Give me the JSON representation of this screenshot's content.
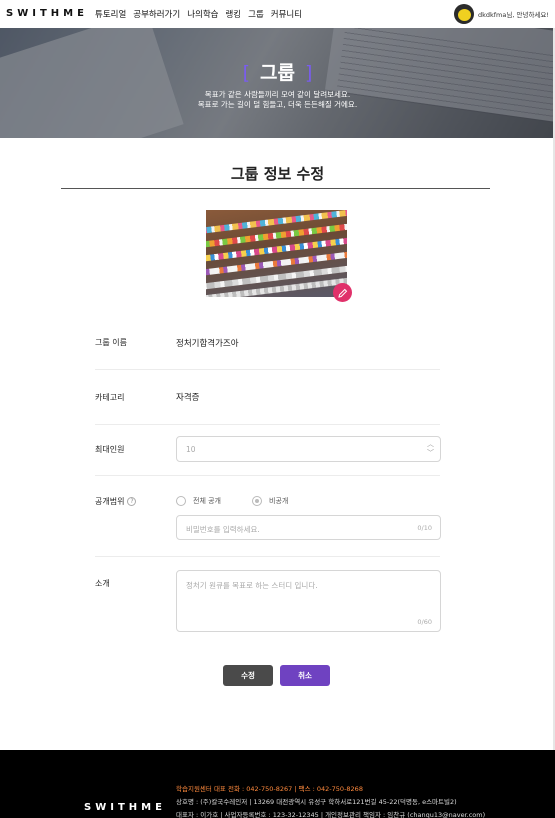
{
  "header": {
    "logo": "SWITHME",
    "nav": [
      "튜토리얼",
      "공부하러가기",
      "나의학습",
      "랭킹",
      "그룹",
      "커뮤니티"
    ],
    "user_greeting": "dkdkfma님, 안녕하세요!"
  },
  "hero": {
    "title": "그룹",
    "bracket_left": "[",
    "bracket_right": "]",
    "subtitle_line1": "목표가 같은 사람들끼리 모여 같이 달려보세요.",
    "subtitle_line2": "목표로 가는 길이 덜 힘들고, 더욱 든든해질 거에요."
  },
  "section": {
    "title": "그룹 정보 수정"
  },
  "form": {
    "group_name_label": "그룹 이름",
    "group_name_value": "정처기합격가즈아",
    "category_label": "카테고리",
    "category_value": "자격증",
    "max_members_label": "최대인원",
    "max_members_value": "10",
    "visibility_label": "공개범위",
    "help_glyph": "?",
    "visibility_options": [
      "전체 공개",
      "비공개"
    ],
    "visibility_selected": "비공개",
    "password_placeholder": "비밀번호를 입력하세요.",
    "password_count": "0/10",
    "intro_label": "소개",
    "intro_placeholder": "정처기 원큐를 목표로 하는 스터디 입니다.",
    "intro_count": "0/60"
  },
  "buttons": {
    "save": "수정",
    "cancel": "취소"
  },
  "footer": {
    "logo": "SWITHME",
    "line1": "학습지원센터 대표 전화 : 042-750-8267   |   팩스 : 042-750-8268",
    "line2": "상호명 : (주)칼국수레인저   |   13269 대전광역시 유성구 학하서로121번길 45-22(덕명동, e스마트빌2)",
    "line3": "대표자 : 이가호   |  사업자등록번호 : 123-32-12345   |  개인정보관리 책임자 : 임찬규 (chanqu13@naver.com)"
  },
  "colors": {
    "accent": "#6f42c1",
    "edit_badge": "#e0316a",
    "footer_highlight": "#ff8a3d"
  }
}
